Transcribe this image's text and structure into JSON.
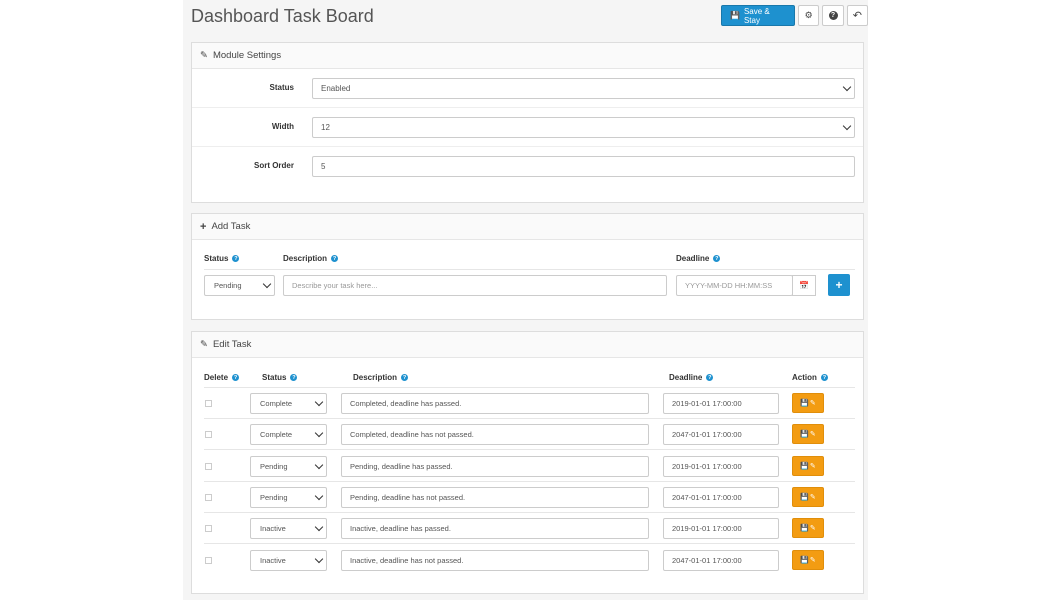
{
  "header": {
    "title": "Dashboard Task Board",
    "save_label": "Save & Stay",
    "save_icon": "floppy-disk-icon",
    "settings_icon": "gear-icon",
    "help_icon": "question-icon",
    "back_icon": "reply-arrow-icon"
  },
  "module_settings": {
    "heading": "Module Settings",
    "status_label": "Status",
    "status_value": "Enabled",
    "width_label": "Width",
    "width_value": "12",
    "sort_label": "Sort Order",
    "sort_value": "5"
  },
  "add_task": {
    "heading": "Add Task",
    "col_status": "Status",
    "col_description": "Description",
    "col_deadline": "Deadline",
    "status_value": "Pending",
    "description_placeholder": "Describe your task here...",
    "deadline_placeholder": "YYYY-MM-DD HH:MM:SS",
    "add_label": "+"
  },
  "edit_task": {
    "heading": "Edit Task",
    "columns": {
      "delete": "Delete",
      "status": "Status",
      "description": "Description",
      "deadline": "Deadline",
      "action": "Action"
    },
    "rows": [
      {
        "status": "Complete",
        "description": "Completed, deadline has passed.",
        "deadline": "2019-01-01 17:00:00"
      },
      {
        "status": "Complete",
        "description": "Completed, deadline has not passed.",
        "deadline": "2047-01-01 17:00:00"
      },
      {
        "status": "Pending",
        "description": "Pending, deadline has passed.",
        "deadline": "2019-01-01 17:00:00"
      },
      {
        "status": "Pending",
        "description": "Pending, deadline has not passed.",
        "deadline": "2047-01-01 17:00:00"
      },
      {
        "status": "Inactive",
        "description": "Inactive, deadline has passed.",
        "deadline": "2019-01-01 17:00:00"
      },
      {
        "status": "Inactive",
        "description": "Inactive, deadline has not passed.",
        "deadline": "2047-01-01 17:00:00"
      }
    ]
  },
  "colors": {
    "primary": "#1e91cf",
    "warning": "#f39c12"
  }
}
